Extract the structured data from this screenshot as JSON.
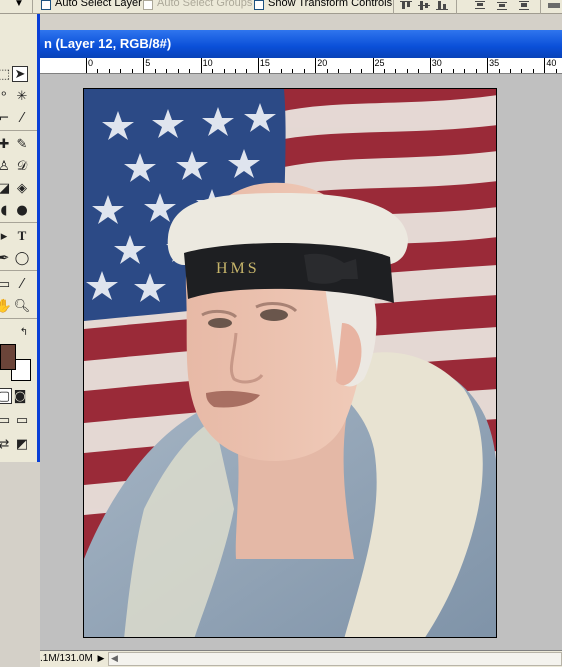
{
  "options_bar": {
    "auto_select_layer": "Auto Select Layer",
    "auto_select_groups": "Auto Select Groups",
    "show_transform_controls": "Show Transform Controls"
  },
  "document": {
    "title": "n (Layer 12, RGB/8#)",
    "ruler_labels": [
      "0",
      "5",
      "10",
      "15",
      "20",
      "25",
      "30",
      "35",
      "40"
    ],
    "status_text": ".1M/131.0M"
  },
  "image": {
    "hat_band_text": "HMS"
  },
  "toolbox": {
    "text_tool_glyph": "T",
    "foreground_color": "#6b4439",
    "background_color": "#ffffff"
  },
  "colors": {
    "titlebar": "#0a4fd8",
    "canvas_bg": "#c0c0c0",
    "flag_blue": "#2c4a86",
    "flag_red": "#9a2a38"
  }
}
